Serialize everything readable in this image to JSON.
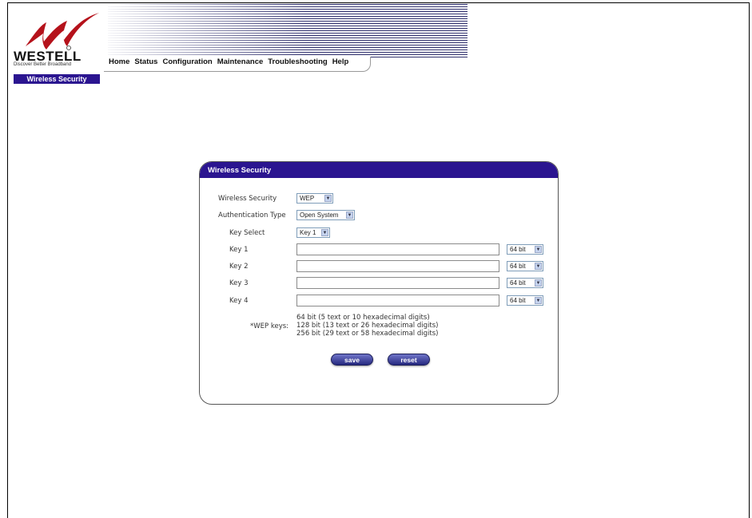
{
  "header": {
    "brand": "WESTELL",
    "tagline": "Discover Better Broadband",
    "page_badge": "Wireless Security"
  },
  "nav": {
    "items": [
      "Home",
      "Status",
      "Configuration",
      "Maintenance",
      "Troubleshooting",
      "Help"
    ]
  },
  "panel": {
    "title": "Wireless Security",
    "wireless_security": {
      "label": "Wireless Security",
      "value": "WEP"
    },
    "authentication_type": {
      "label": "Authentication Type",
      "value": "Open System"
    },
    "key_select": {
      "label": "Key Select",
      "value": "Key 1"
    },
    "keys": [
      {
        "label": "Key 1",
        "value": "",
        "bits": "64 bit"
      },
      {
        "label": "Key 2",
        "value": "",
        "bits": "64 bit"
      },
      {
        "label": "Key 3",
        "value": "",
        "bits": "64 bit"
      },
      {
        "label": "Key 4",
        "value": "",
        "bits": "64 bit"
      }
    ],
    "wep_note_label": "*WEP keys:",
    "wep_notes": [
      "64 bit (5 text or 10 hexadecimal digits)",
      "128 bit (13 text or 26 hexadecimal digits)",
      "256 bit (29 text or 58 hexadecimal digits)"
    ],
    "save_label": "save",
    "reset_label": "reset"
  },
  "colors": {
    "accent": "#2b1590",
    "logo_red": "#b5121b"
  }
}
